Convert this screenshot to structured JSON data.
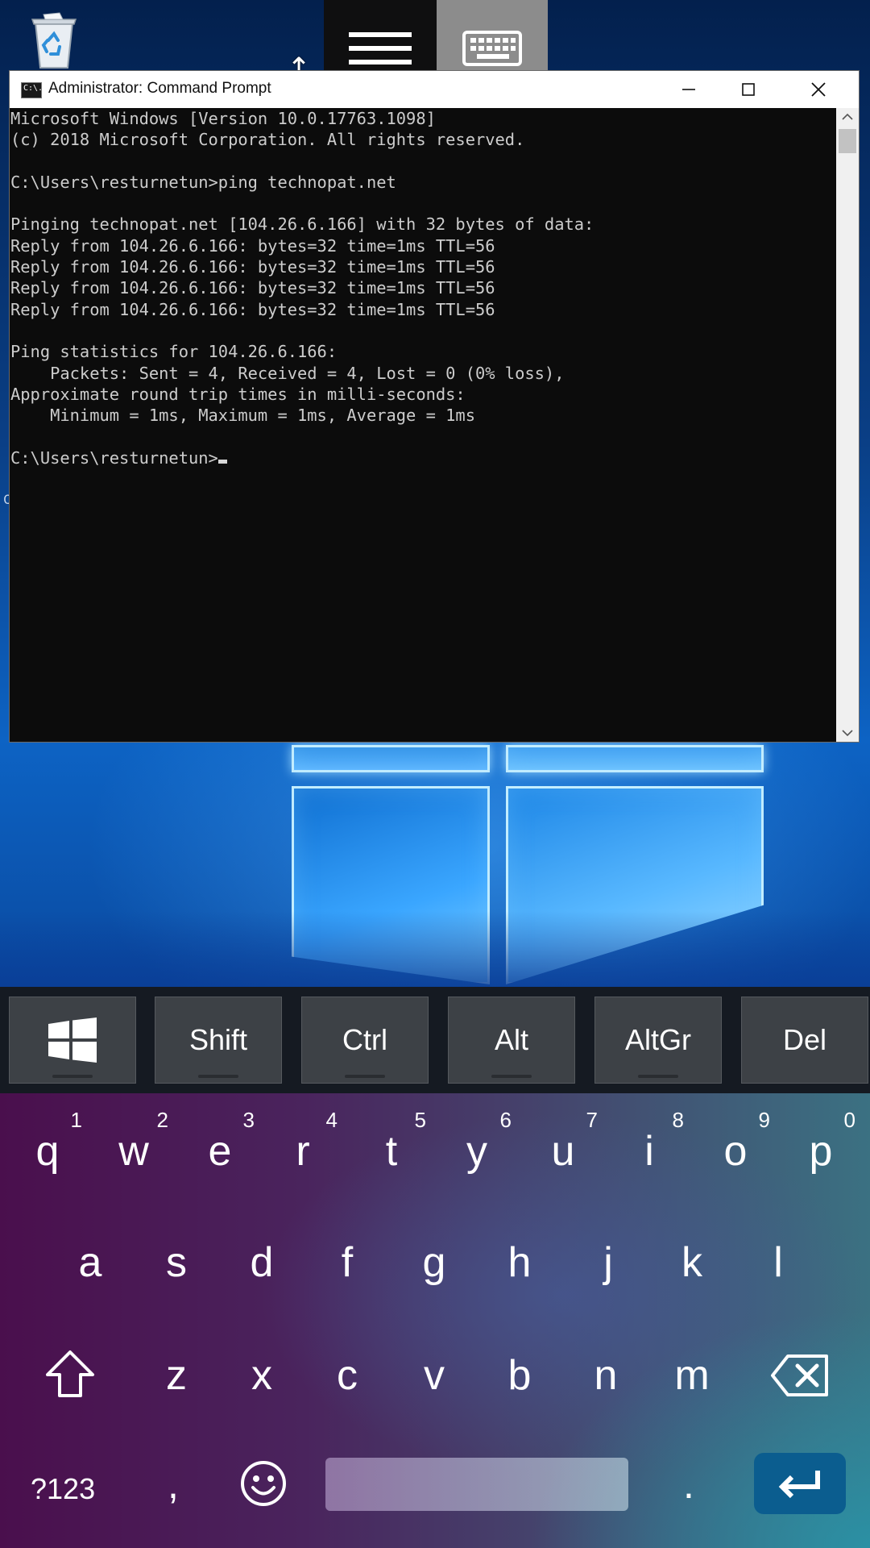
{
  "window": {
    "title": "Administrator: Command Prompt",
    "icon_text": "C:\\.",
    "buttons": [
      "minimize-icon",
      "maximize-icon",
      "close-icon"
    ]
  },
  "terminal": {
    "lines": [
      "Microsoft Windows [Version 10.0.17763.1098]",
      "(c) 2018 Microsoft Corporation. All rights reserved.",
      "",
      "C:\\Users\\resturnetun>ping technopat.net",
      "",
      "Pinging technopat.net [104.26.6.166] with 32 bytes of data:",
      "Reply from 104.26.6.166: bytes=32 time=1ms TTL=56",
      "Reply from 104.26.6.166: bytes=32 time=1ms TTL=56",
      "Reply from 104.26.6.166: bytes=32 time=1ms TTL=56",
      "Reply from 104.26.6.166: bytes=32 time=1ms TTL=56",
      "",
      "Ping statistics for 104.26.6.166:",
      "    Packets: Sent = 4, Received = 4, Lost = 0 (0% loss),",
      "Approximate round trip times in milli-seconds:",
      "    Minimum = 1ms, Maximum = 1ms, Average = 1ms",
      ""
    ],
    "prompt": "C:\\Users\\resturnetun>"
  },
  "desktop": {
    "stray_char": "C",
    "icons": [
      "recycle-bin-icon"
    ]
  },
  "floating_toolbar": {
    "items": [
      "menu-icon",
      "keyboard-icon"
    ]
  },
  "special_keys": [
    "windows-icon",
    "Shift",
    "Ctrl",
    "Alt",
    "AltGr",
    "Del"
  ],
  "keyboard": {
    "row1": [
      {
        "key": "q",
        "hint": "1"
      },
      {
        "key": "w",
        "hint": "2"
      },
      {
        "key": "e",
        "hint": "3"
      },
      {
        "key": "r",
        "hint": "4"
      },
      {
        "key": "t",
        "hint": "5"
      },
      {
        "key": "y",
        "hint": "6"
      },
      {
        "key": "u",
        "hint": "7"
      },
      {
        "key": "i",
        "hint": "8"
      },
      {
        "key": "o",
        "hint": "9"
      },
      {
        "key": "p",
        "hint": "0"
      }
    ],
    "row2": [
      "a",
      "s",
      "d",
      "f",
      "g",
      "h",
      "j",
      "k",
      "l"
    ],
    "row3": [
      "z",
      "x",
      "c",
      "v",
      "b",
      "n",
      "m"
    ],
    "numbers_label": "?123",
    "comma": ",",
    "period": ".",
    "icons": [
      "shift-icon",
      "backspace-icon",
      "emoji-icon",
      "enter-icon"
    ]
  },
  "colors": {
    "terminal_bg": "#0c0c0c",
    "terminal_fg": "#cccccc",
    "enter_key": "#0b5d8f",
    "special_key": "#3d4146"
  }
}
